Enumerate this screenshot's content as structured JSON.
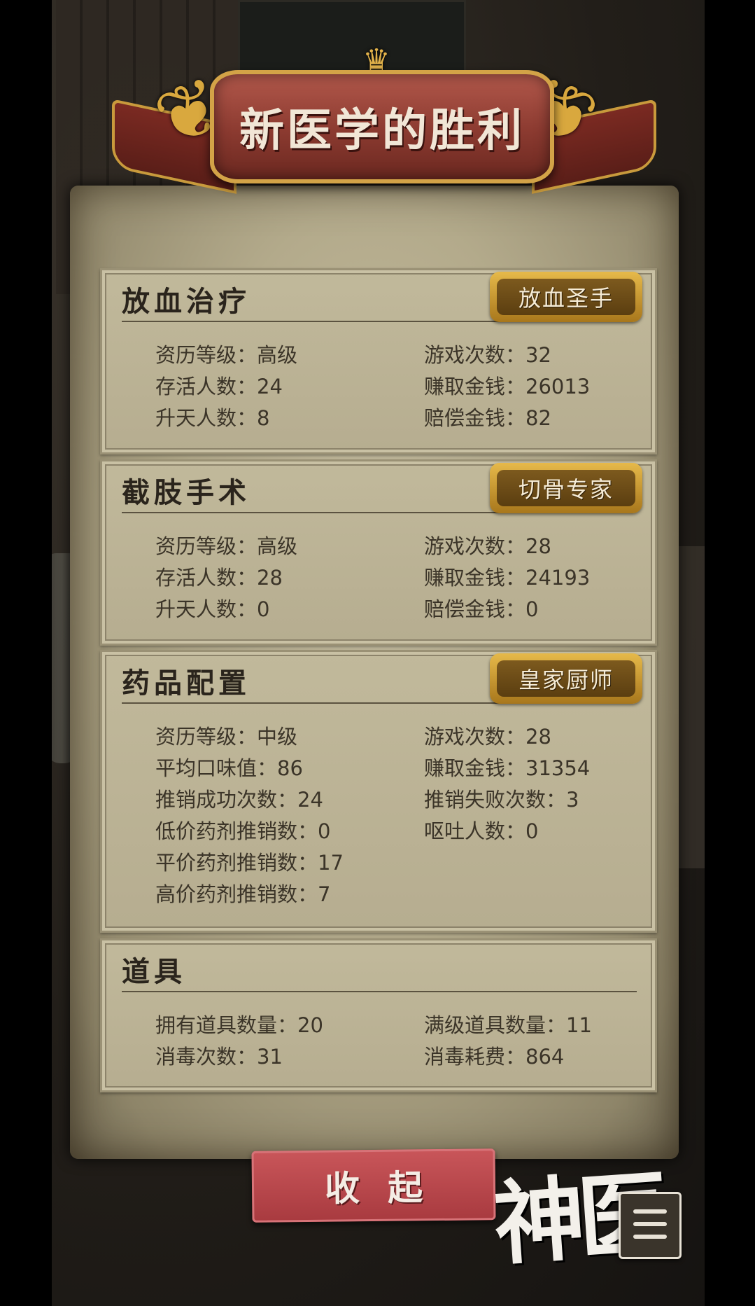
{
  "header": {
    "title": "新医学的胜利"
  },
  "sections": {
    "bloodletting": {
      "title": "放血治疗",
      "badge": "放血圣手",
      "stats": {
        "level": "资历等级：高级",
        "games": "游戏次数：32",
        "survivors": "存活人数：24",
        "earned": "赚取金钱：26013",
        "ascended": "升天人数：8",
        "compensation": "赔偿金钱：82"
      }
    },
    "amputation": {
      "title": "截肢手术",
      "badge": "切骨专家",
      "stats": {
        "level": "资历等级：高级",
        "games": "游戏次数：28",
        "survivors": "存活人数：28",
        "earned": "赚取金钱：24193",
        "ascended": "升天人数：0",
        "compensation": "赔偿金钱：0"
      }
    },
    "medicine": {
      "title": "药品配置",
      "badge": "皇家厨师",
      "stats": {
        "level": "资历等级：中级",
        "games": "游戏次数：28",
        "avg_taste": "平均口味值：86",
        "earned": "赚取金钱：31354",
        "promo_success": "推销成功次数：24",
        "promo_fail": "推销失败次数：3",
        "low_price": "低价药剂推销数：0",
        "vomit": "呕吐人数：0",
        "mid_price": "平价药剂推销数：17",
        "high_price": "高价药剂推销数：7"
      }
    },
    "items": {
      "title": "道具",
      "stats": {
        "owned": "拥有道具数量：20",
        "maxed": "满级道具数量：11",
        "disinfect_count": "消毒次数：31",
        "disinfect_cost": "消毒耗费：864"
      }
    }
  },
  "footer": {
    "collapse_label": "收起",
    "logo_text": "神医",
    "menu_icon": "list-menu-icon"
  },
  "colors": {
    "ribbon": "#8b3a30",
    "gold": "#d3a347",
    "parchment": "#b6ad90",
    "button": "#b8444a"
  }
}
